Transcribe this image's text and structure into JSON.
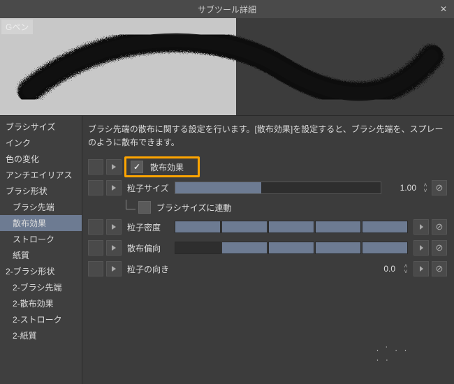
{
  "window": {
    "title": "サブツール詳細"
  },
  "preview": {
    "brush_label": "Gペン"
  },
  "sidebar": {
    "items": [
      {
        "label": "ブラシサイズ",
        "indent": false,
        "sel": false
      },
      {
        "label": "インク",
        "indent": false,
        "sel": false
      },
      {
        "label": "色の変化",
        "indent": false,
        "sel": false
      },
      {
        "label": "アンチエイリアス",
        "indent": false,
        "sel": false
      },
      {
        "label": "ブラシ形状",
        "indent": false,
        "sel": false
      },
      {
        "label": "ブラシ先端",
        "indent": true,
        "sel": false
      },
      {
        "label": "散布効果",
        "indent": true,
        "sel": true
      },
      {
        "label": "ストローク",
        "indent": true,
        "sel": false
      },
      {
        "label": "紙質",
        "indent": true,
        "sel": false
      },
      {
        "label": "2-ブラシ形状",
        "indent": false,
        "sel": false
      },
      {
        "label": "2-ブラシ先端",
        "indent": true,
        "sel": false
      },
      {
        "label": "2-散布効果",
        "indent": true,
        "sel": false
      },
      {
        "label": "2-ストローク",
        "indent": true,
        "sel": false
      },
      {
        "label": "2-紙質",
        "indent": true,
        "sel": false
      }
    ]
  },
  "main": {
    "description": "ブラシ先端の散布に関する設定を行います。[散布効果]を設定すると、ブラシ先端を、スプレーのように散布できます。",
    "scatter_effect": {
      "label": "散布効果",
      "checked": true
    },
    "particle_size": {
      "label": "粒子サイズ",
      "value": "1.00",
      "fill_pct": 42
    },
    "link_brush_size": {
      "label": "ブラシサイズに連動",
      "checked": false
    },
    "particle_density": {
      "label": "粒子密度"
    },
    "scatter_deviation": {
      "label": "散布偏向"
    },
    "particle_orientation": {
      "label": "粒子の向き",
      "value": "0.0"
    }
  },
  "icons": {
    "close": "✕"
  }
}
